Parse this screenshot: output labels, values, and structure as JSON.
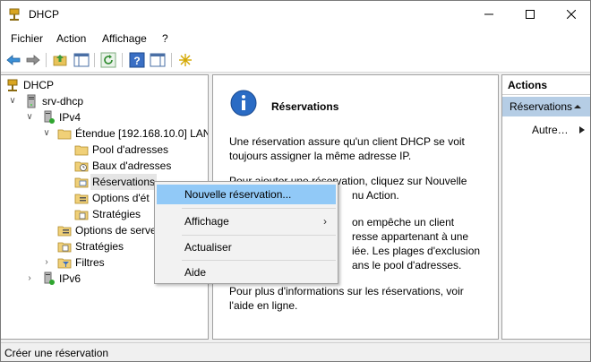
{
  "window": {
    "title": "DHCP"
  },
  "menubar": [
    "Fichier",
    "Action",
    "Affichage",
    "?"
  ],
  "tree": {
    "root": "DHCP",
    "server": "srv-dhcp",
    "ipv4": "IPv4",
    "scope": "Étendue [192.168.10.0] LAN",
    "pool": "Pool d'adresses",
    "leases": "Baux d'adresses",
    "reservations": "Réservations",
    "scope_options": "Options d'ét",
    "scope_policies": "Stratégies",
    "server_options": "Options de serve",
    "policies": "Stratégies",
    "filters": "Filtres",
    "ipv6": "IPv6"
  },
  "center": {
    "title": "Réservations",
    "para1": "Une réservation assure qu'un client DHCP se voit toujours assigner la même adresse IP.",
    "para2_line1": "Pour ajouter une réservation, cliquez sur Nouvelle",
    "para2_line2": "nu Action.",
    "para3_line1": "on empêche un client",
    "para3_line2": "resse appartenant à une",
    "para3_line3": "iée. Les plages d'exclusion",
    "para3_line4": "ans le pool d'adresses.",
    "para4": "Pour plus d'informations sur les réservations, voir l'aide en ligne."
  },
  "actions": {
    "header": "Actions",
    "selected": "Réservations",
    "more": "Autre…"
  },
  "context_menu": {
    "new_reservation": "Nouvelle réservation...",
    "view": "Affichage",
    "refresh": "Actualiser",
    "help": "Aide"
  },
  "status": {
    "text": "Créer une réservation"
  }
}
